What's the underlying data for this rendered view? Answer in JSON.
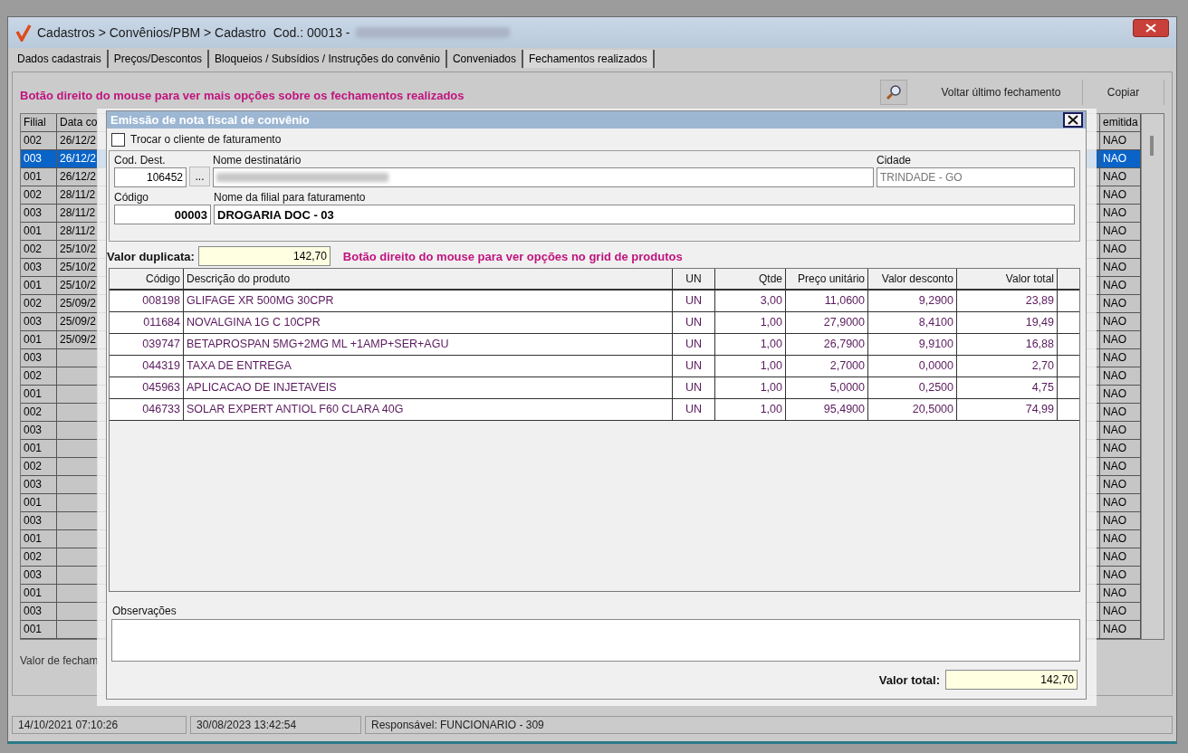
{
  "window": {
    "title": "Cadastros > Convênios/PBM > Cadastro  Cod.: 00013 -",
    "title_redacted": true
  },
  "tabs": [
    {
      "label": "Dados cadastrais",
      "selected": false
    },
    {
      "label": "Preços/Descontos",
      "selected": false
    },
    {
      "label": "Bloqueios / Subsídios / Instruções do convênio",
      "selected": false
    },
    {
      "label": "Conveniados",
      "selected": false
    },
    {
      "label": "Fechamentos realizados",
      "selected": true
    }
  ],
  "closings": {
    "hint": "Botão direito do mouse para ver mais opções sobre os fechamentos realizados",
    "buttons": [
      "Voltar último fechamento",
      "Copiar"
    ],
    "grid": {
      "columns": [
        "Filial",
        "Data co",
        "emitida"
      ],
      "rows": [
        {
          "filial": "002",
          "date": "26/12/2",
          "issued": "NAO",
          "selected": false
        },
        {
          "filial": "003",
          "date": "26/12/2",
          "issued": "NAO",
          "selected": true
        },
        {
          "filial": "001",
          "date": "26/12/2",
          "issued": "NAO",
          "selected": false
        },
        {
          "filial": "002",
          "date": "28/11/2",
          "issued": "NAO",
          "selected": false
        },
        {
          "filial": "003",
          "date": "28/11/2",
          "issued": "NAO",
          "selected": false
        },
        {
          "filial": "001",
          "date": "28/11/2",
          "issued": "NAO",
          "selected": false
        },
        {
          "filial": "002",
          "date": "25/10/2",
          "issued": "NAO",
          "selected": false
        },
        {
          "filial": "003",
          "date": "25/10/2",
          "issued": "NAO",
          "selected": false
        },
        {
          "filial": "001",
          "date": "25/10/2",
          "issued": "NAO",
          "selected": false
        },
        {
          "filial": "002",
          "date": "25/09/2",
          "issued": "NAO",
          "selected": false
        },
        {
          "filial": "003",
          "date": "25/09/2",
          "issued": "NAO",
          "selected": false
        },
        {
          "filial": "001",
          "date": "25/09/2",
          "issued": "NAO",
          "selected": false
        },
        {
          "filial": "003",
          "issued": "NAO",
          "selected": false
        },
        {
          "filial": "002",
          "issued": "NAO",
          "selected": false
        },
        {
          "filial": "001",
          "issued": "NAO",
          "selected": false
        },
        {
          "filial": "002",
          "issued": "NAO",
          "selected": false
        },
        {
          "filial": "003",
          "issued": "NAO",
          "selected": false
        },
        {
          "filial": "001",
          "issued": "NAO",
          "selected": false
        },
        {
          "filial": "002",
          "issued": "NAO",
          "selected": false
        },
        {
          "filial": "003",
          "issued": "NAO",
          "selected": false
        },
        {
          "filial": "001",
          "issued": "NAO",
          "selected": false
        },
        {
          "filial": "003",
          "issued": "NAO",
          "selected": false
        },
        {
          "filial": "001",
          "issued": "NAO",
          "selected": false
        },
        {
          "filial": "002",
          "issued": "NAO",
          "selected": false
        },
        {
          "filial": "003",
          "issued": "NAO",
          "selected": false
        },
        {
          "filial": "001",
          "issued": "NAO",
          "selected": false
        },
        {
          "filial": "003",
          "issued": "NAO",
          "selected": false
        },
        {
          "filial": "001",
          "issued": "NAO",
          "selected": false
        }
      ]
    },
    "footer_label": "Valor de fecham"
  },
  "dialog": {
    "title": "Emissão de nota fiscal de convênio",
    "change_client": {
      "label": "Trocar o cliente de faturamento",
      "checked": false
    },
    "recipient": {
      "code_label": "Cod. Dest.",
      "code": "106452",
      "lookup": "...",
      "name_label": "Nome destinatário",
      "name_redacted": true,
      "city_label": "Cidade",
      "city": "TRINDADE - GO",
      "city_disabled": true
    },
    "branch": {
      "code_label": "Código",
      "code": "00003",
      "name_label": "Nome da filial para faturamento",
      "name": "DROGARIA DOC - 03"
    },
    "duplicate": {
      "label": "Valor duplicata:",
      "value": "142,70",
      "hint": "Botão direito do mouse para ver opções no grid de produtos"
    },
    "products": {
      "columns": [
        "Código",
        "Descrição do produto",
        "UN",
        "Qtde",
        "Preço unitário",
        "Valor desconto",
        "Valor total"
      ],
      "rows": [
        [
          "008198",
          "GLIFAGE XR 500MG 30CPR",
          "UN",
          "3,00",
          "11,0600",
          "9,2900",
          "23,89"
        ],
        [
          "011684",
          "NOVALGINA 1G C 10CPR",
          "UN",
          "1,00",
          "27,9000",
          "8,4100",
          "19,49"
        ],
        [
          "039747",
          "BETAPROSPAN 5MG+2MG ML +1AMP+SER+AGU",
          "UN",
          "1,00",
          "26,7900",
          "9,9100",
          "16,88"
        ],
        [
          "044319",
          "TAXA DE ENTREGA",
          "UN",
          "1,00",
          "2,7000",
          "0,0000",
          "2,70"
        ],
        [
          "045963",
          "APLICACAO DE INJETAVEIS",
          "UN",
          "1,00",
          "5,0000",
          "0,2500",
          "4,75"
        ],
        [
          "046733",
          "SOLAR EXPERT ANTIOL F60 CLARA 40G",
          "UN",
          "1,00",
          "95,4900",
          "20,5000",
          "74,99"
        ]
      ]
    },
    "observations": {
      "label": "Observações"
    },
    "total": {
      "label": "Valor total:",
      "value": "142,70"
    }
  },
  "status_bar": [
    "14/10/2021 07:10:26",
    "30/08/2023 13:42:54",
    "Responsável: FUNCIONARIO - 309"
  ]
}
